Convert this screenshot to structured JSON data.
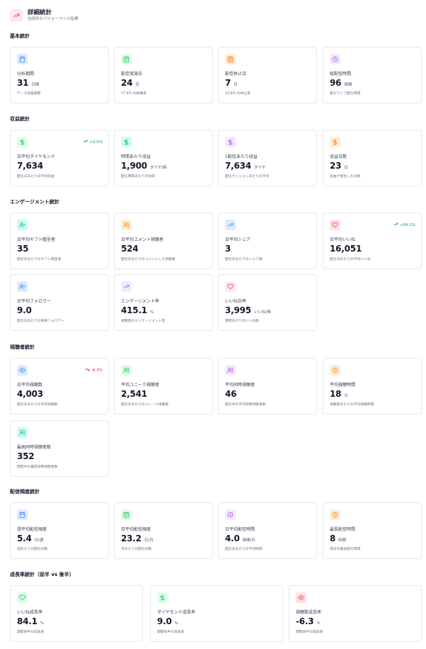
{
  "header": {
    "title": "詳細統計",
    "subtitle": "包括的なパフォーマンス指標"
  },
  "sections": {
    "basic": {
      "title": "基本統計",
      "cards": [
        {
          "label": "分析期間",
          "value": "31",
          "unit": "日間",
          "desc": "データ収集期間",
          "icon": "calendar-icon",
          "color": "blue"
        },
        {
          "label": "配信実施日",
          "value": "24",
          "unit": "日",
          "desc": "77.4% の稼働率",
          "icon": "calendar-check-icon",
          "color": "green"
        },
        {
          "label": "配信休止日",
          "value": "7",
          "unit": "日",
          "desc": "22.6% の休止率",
          "icon": "calendar-x-icon",
          "color": "orange"
        },
        {
          "label": "総配信時間",
          "value": "96",
          "unit": "時間",
          "desc": "累計ライブ配信時間",
          "icon": "clock-icon",
          "color": "purple"
        }
      ]
    },
    "revenue": {
      "title": "収益統計",
      "cards": [
        {
          "label": "日平均ダイヤモンド",
          "value": "7,634",
          "unit": "",
          "desc": "配信日あたりの平均収益",
          "icon": "dollar-icon",
          "color": "green",
          "trend": "+9.0%",
          "trend_dir": "up"
        },
        {
          "label": "時間あたり収益",
          "value": "1,900",
          "unit": "ダイヤ/時",
          "desc": "配信時間あたりの効率",
          "icon": "dollar-icon",
          "color": "teal"
        },
        {
          "label": "1配信あたり収益",
          "value": "7,634",
          "unit": "ダイヤ",
          "desc": "配信セッションあたりの平均",
          "icon": "dollar-icon",
          "color": "purple"
        },
        {
          "label": "収益日数",
          "value": "23",
          "unit": "日",
          "desc": "収益が発生した日数",
          "icon": "dollar-icon",
          "color": "orange"
        }
      ]
    },
    "engagement": {
      "title": "エンゲージメント統計",
      "cards": [
        {
          "label": "日平均ギフト贈呈者",
          "value": "35",
          "unit": "",
          "desc": "配信日あたりのギフト贈呈者",
          "icon": "user-plus-icon",
          "color": "teal"
        },
        {
          "label": "日平均コメント視聴者",
          "value": "524",
          "unit": "",
          "desc": "配信日あたりのコメントした視聴者",
          "icon": "users-icon",
          "color": "orange"
        },
        {
          "label": "日平均シェア",
          "value": "3",
          "unit": "",
          "desc": "配信日あたりのシェア数",
          "icon": "trending-up-icon",
          "color": "blue"
        },
        {
          "label": "日平均いいね",
          "value": "16,051",
          "unit": "",
          "desc": "配信日あたりの平均いいね",
          "icon": "heart-icon",
          "color": "red",
          "trend": "+84.1%",
          "trend_dir": "up"
        },
        {
          "label": "日平均フォロワー",
          "value": "9.0",
          "unit": "",
          "desc": "配信日あたりの新規フォロワー",
          "icon": "user-plus-icon",
          "color": "blue"
        },
        {
          "label": "エンゲージメント率",
          "value": "415.1",
          "unit": "%",
          "desc": "視聴者のエンゲージメント度",
          "icon": "trending-up-icon",
          "color": "purple"
        },
        {
          "label": "いいね効率",
          "value": "3,995",
          "unit": "いいね/時",
          "desc": "時間あたりのいいね数",
          "icon": "heart-icon",
          "color": "pink"
        }
      ]
    },
    "viewers": {
      "title": "視聴者統計",
      "cards": [
        {
          "label": "日平均視聴数",
          "value": "4,003",
          "unit": "",
          "desc": "配信日あたりの平均視聴数",
          "icon": "eye-icon",
          "color": "blue",
          "trend": "-6.3%",
          "trend_dir": "down"
        },
        {
          "label": "平均ユニーク視聴者",
          "value": "2,541",
          "unit": "",
          "desc": "配信日あたりのユニーク視聴者",
          "icon": "users-icon",
          "color": "green"
        },
        {
          "label": "平均同時視聴者",
          "value": "46",
          "unit": "",
          "desc": "配信中の平均同時視聴者数",
          "icon": "users-icon",
          "color": "purple"
        },
        {
          "label": "平均視聴時間",
          "value": "18",
          "unit": "分",
          "desc": "視聴者あたりの平均視聴時間",
          "icon": "clock-icon",
          "color": "orange"
        },
        {
          "label": "最高同時視聴者数",
          "value": "352",
          "unit": "",
          "desc": "期間中の最高同時視聴者数",
          "icon": "users-icon",
          "color": "teal"
        }
      ]
    },
    "frequency": {
      "title": "配信頻度統計",
      "cards": [
        {
          "label": "週平均配信頻度",
          "value": "5.4",
          "unit": "日/週",
          "desc": "週あたりの配信日数",
          "icon": "calendar-icon",
          "color": "blue"
        },
        {
          "label": "月平均配信頻度",
          "value": "23.2",
          "unit": "日/月",
          "desc": "月あたりの配信日数",
          "icon": "calendar-check-icon",
          "color": "green"
        },
        {
          "label": "日平均配信時間",
          "value": "4.0",
          "unit": "時間/日",
          "desc": "配信日あたりの平均時間",
          "icon": "clock-icon",
          "color": "purple"
        },
        {
          "label": "最長配信時間",
          "value": "8",
          "unit": "時間",
          "desc": "単日の最長配信時間",
          "icon": "clock-icon",
          "color": "orange"
        }
      ]
    },
    "growth": {
      "title": "成長率統計（前半 vs 後半）",
      "cards": [
        {
          "label": "いいね成長率",
          "value": "84.1",
          "unit": "%",
          "desc": "期間後半の成長率",
          "icon": "heart-icon",
          "color": "green"
        },
        {
          "label": "ダイヤモンド成長率",
          "value": "9.0",
          "unit": "%",
          "desc": "期間後半の成長率",
          "icon": "dollar-icon",
          "color": "green"
        },
        {
          "label": "視聴数成長率",
          "value": "-6.3",
          "unit": "%",
          "desc": "期間後半の成長率",
          "icon": "eye-icon",
          "color": "red"
        }
      ]
    }
  }
}
